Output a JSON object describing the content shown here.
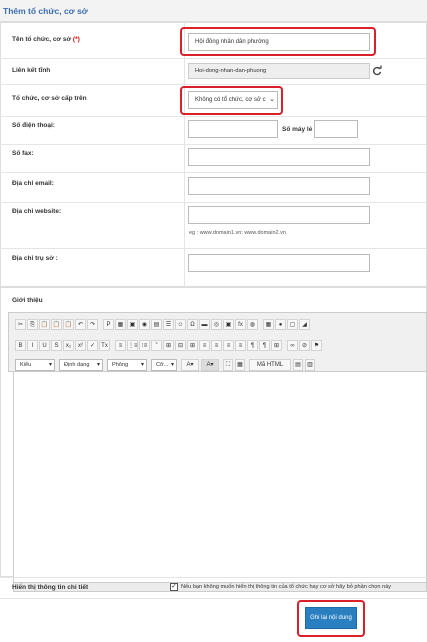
{
  "page": {
    "title": "Thêm tổ chức, cơ sở"
  },
  "form": {
    "name": {
      "label": "Tên tổ chức, cơ sở",
      "required_mark": "(*)",
      "value": "Hội đồng nhân dân phường"
    },
    "link": {
      "label": "Liên kết tĩnh",
      "value": "Hoi-dong-nhan-dan-phuong",
      "icon": "refresh-icon"
    },
    "parent": {
      "label": "Tổ chức, cơ sở cấp trên",
      "value": "Không có tổ chức, cơ sở c"
    },
    "phone": {
      "label": "Số điện thoại:",
      "value": ""
    },
    "extension": {
      "label": "Số máy lẻ :",
      "value": ""
    },
    "fax": {
      "label": "Số fax:",
      "value": ""
    },
    "email": {
      "label": "Địa chỉ email:",
      "value": ""
    },
    "website": {
      "label": "Địa chỉ website:",
      "value": "",
      "hint": "eg : www.domain1.vn; www.domain2.vn"
    },
    "address": {
      "label": "Địa chỉ trụ sở :",
      "value": ""
    },
    "intro": {
      "label": "Giới thiệu"
    },
    "show_detail": {
      "label": "Hiển thị thông tin chi tiết",
      "checked": true,
      "text": "Nếu bạn không muốn hiển thị thông tin của tổ chức hay cơ sở hãy bỏ phần chọn này"
    }
  },
  "editor": {
    "row1": [
      "✂",
      "⎘",
      "📋",
      "📋",
      "📋",
      "↶",
      "↷",
      "|",
      "P",
      "▦",
      "▣",
      "◉",
      "▤",
      "☰",
      "☺",
      "Ω",
      "▬",
      "◎",
      "▣",
      "fx",
      "◍",
      "|",
      "▦",
      "●",
      "▢",
      "◢"
    ],
    "row2": [
      "B",
      "I",
      "U",
      "S",
      "x₂",
      "x²",
      "✓",
      "Tx",
      "|",
      "≡",
      "⋮≡",
      "⁝≡",
      "”",
      "⊞",
      "⊟",
      "⊞",
      "≡",
      "≡",
      "≡",
      "≡",
      "¶",
      "¶",
      "⊞",
      "|",
      "∞",
      "⊘",
      "⚑"
    ],
    "combos": {
      "style": "Kiểu",
      "format": "Định dạng",
      "font": "Phông",
      "size": "Cỡ...",
      "html": "Mã HTML"
    },
    "colors": {
      "text": "A",
      "bg": "A"
    }
  },
  "actions": {
    "save": "Ghi lại nội dung"
  },
  "colors": {
    "title": "#3c6fb0",
    "highlight": "#d9202b",
    "primary_btn": "#2a7fc0"
  }
}
